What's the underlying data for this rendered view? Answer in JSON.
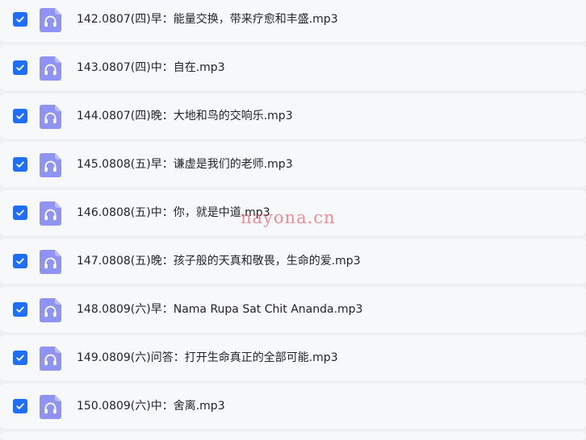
{
  "files": [
    {
      "name": "142.0807(四)早：能量交换，带来疗愈和丰盛.mp3",
      "checked": true,
      "icon": "headphones-icon"
    },
    {
      "name": "143.0807(四)中：自在.mp3",
      "checked": true,
      "icon": "headphones-icon"
    },
    {
      "name": "144.0807(四)晚：大地和鸟的交响乐.mp3",
      "checked": true,
      "icon": "headphones-icon"
    },
    {
      "name": "145.0808(五)早：谦虚是我们的老师.mp3",
      "checked": true,
      "icon": "headphones-icon"
    },
    {
      "name": "146.0808(五)中：你，就是中道.mp3",
      "checked": true,
      "icon": "headphones-icon"
    },
    {
      "name": "147.0808(五)晚：孩子般的天真和敬畏，生命的爱.mp3",
      "checked": true,
      "icon": "headphones-icon"
    },
    {
      "name": "148.0809(六)早：Nama Rupa Sat Chit Ananda.mp3",
      "checked": true,
      "icon": "headphones-icon"
    },
    {
      "name": "149.0809(六)问答：打开生命真正的全部可能.mp3",
      "checked": true,
      "icon": "headphones-icon"
    },
    {
      "name": "150.0809(六)中：舍离.mp3",
      "checked": true,
      "icon": "headphones-icon"
    }
  ],
  "watermark": "nayona.cn",
  "colors": {
    "checkbox": "#1e6fff",
    "icon_bg": "#8f93f5",
    "row_bg": "#f7f8fa",
    "page_bg": "#eef0f4",
    "watermark": "#e25460"
  }
}
